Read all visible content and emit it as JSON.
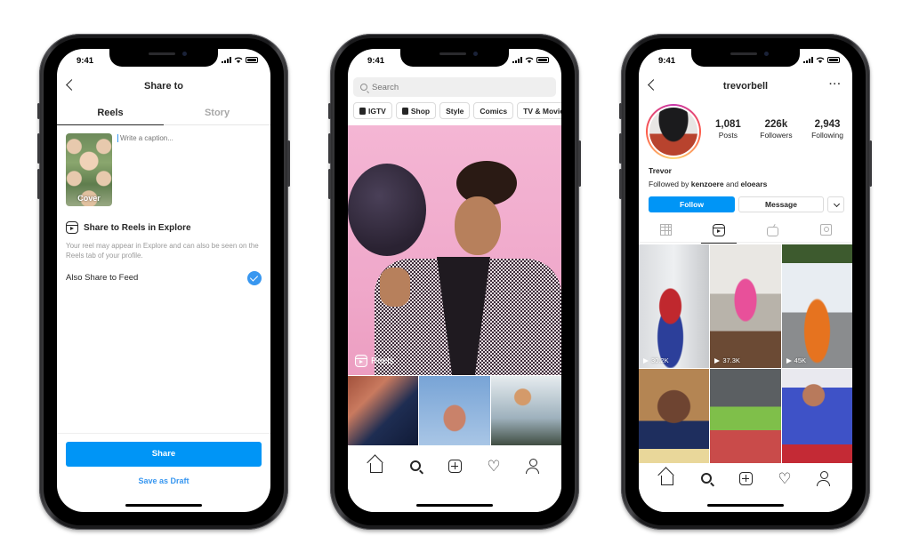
{
  "status_bar": {
    "time": "9:41"
  },
  "share_screen": {
    "title": "Share to",
    "tabs": [
      {
        "label": "Reels",
        "active": true
      },
      {
        "label": "Story",
        "active": false
      }
    ],
    "cover_label": "Cover",
    "caption_placeholder": "Write a caption...",
    "explore_title": "Share to Reels in Explore",
    "explore_description": "Your reel may appear in Explore and can also be seen on the Reels tab of your profile.",
    "also_share_label": "Also Share to Feed",
    "also_share_checked": true,
    "share_button": "Share",
    "save_draft_link": "Save as Draft",
    "accent_color": "#0095f6"
  },
  "explore_screen": {
    "search_placeholder": "Search",
    "chips": [
      {
        "label": "IGTV",
        "icon": "igtv-icon"
      },
      {
        "label": "Shop",
        "icon": "shop-bag-icon"
      },
      {
        "label": "Style",
        "icon": null
      },
      {
        "label": "Comics",
        "icon": null
      },
      {
        "label": "TV & Movie",
        "icon": null
      }
    ],
    "hero_tag": "Reels"
  },
  "profile_screen": {
    "username": "trevorbell",
    "stats": [
      {
        "value": "1,081",
        "label": "Posts"
      },
      {
        "value": "226k",
        "label": "Followers"
      },
      {
        "value": "2,943",
        "label": "Following"
      }
    ],
    "display_name": "Trevor",
    "followed_by_prefix": "Followed by",
    "followed_by_users": [
      "kenzoere",
      "eloears"
    ],
    "followed_by_joiner": "and",
    "follow_button": "Follow",
    "message_button": "Message",
    "tabs": [
      "grid-icon",
      "reels-icon",
      "igtv-icon",
      "tagged-icon"
    ],
    "active_tab": "reels-icon",
    "reels": [
      {
        "views": "30.2K"
      },
      {
        "views": "37.3K"
      },
      {
        "views": "45K"
      },
      {
        "views": null
      },
      {
        "views": null
      },
      {
        "views": null
      }
    ]
  },
  "tab_bar": [
    "home-icon",
    "search-icon",
    "add-icon",
    "heart-icon",
    "profile-icon"
  ]
}
